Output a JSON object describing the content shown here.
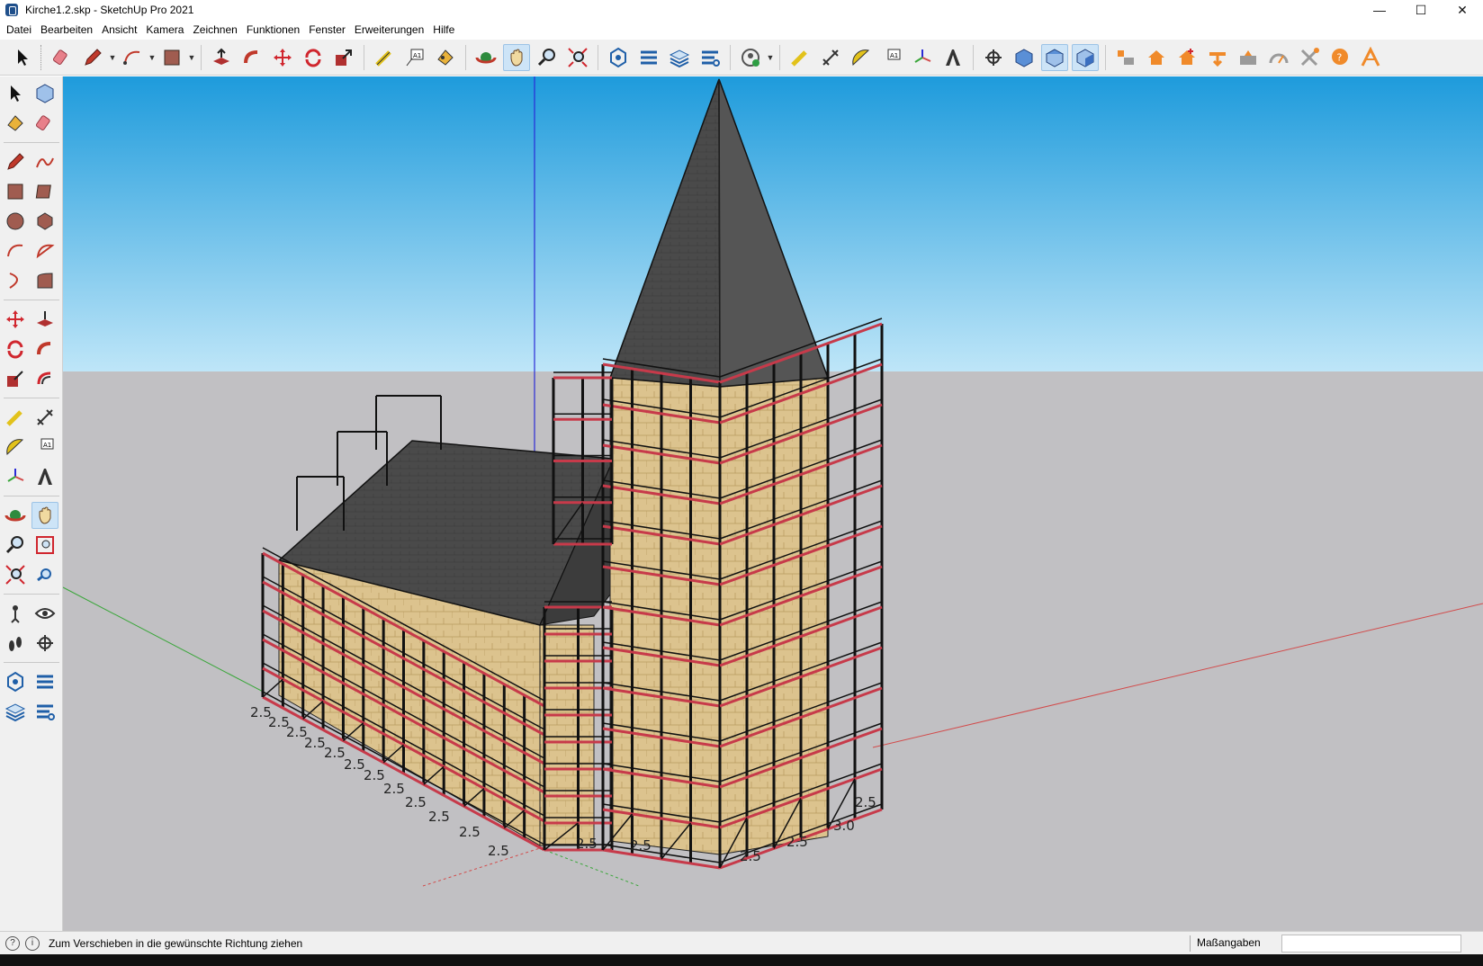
{
  "window": {
    "title": "Kirche1.2.skp - SketchUp Pro 2021",
    "minimize": "—",
    "maximize": "☐",
    "close": "✕"
  },
  "menu": [
    "Datei",
    "Bearbeiten",
    "Ansicht",
    "Kamera",
    "Zeichnen",
    "Funktionen",
    "Fenster",
    "Erweiterungen",
    "Hilfe"
  ],
  "status": {
    "message": "Zum Verschieben in die gewünschte Richtung ziehen",
    "measure_label": "Maßangaben",
    "measure_value": "",
    "info_icon": "i",
    "help_icon": "?"
  },
  "scene": {
    "dimension_labels": [
      "2.5",
      "2.5",
      "2.5",
      "2.5",
      "2.5",
      "2.5",
      "2.5",
      "2.5",
      "2.5",
      "2.5",
      "2.5",
      "2.5",
      "2.5",
      "2.5",
      "2.5",
      "2.5",
      "3.0",
      "2.5"
    ],
    "colors": {
      "sky_top": "#1e9bdc",
      "sky_bottom": "#bfe6f8",
      "ground": "#c1c0c3",
      "roof": "#4a4a4a",
      "wall": "#dcc38e",
      "scaffold": "#111111",
      "deck": "#c73a4a",
      "axis_red": "#d24b4b",
      "axis_green": "#3aa63a",
      "axis_blue": "#2b2bd6"
    }
  },
  "icons": {
    "top": [
      "select-icon",
      "eraser-icon",
      "pencil-icon",
      "arc-icon",
      "rectangle-icon",
      "pushpull-icon",
      "followme-icon",
      "move-icon",
      "rotate-icon",
      "scale-icon",
      "tape-icon",
      "text-icon",
      "paint-icon",
      "orbit-icon",
      "pan-icon",
      "zoom-icon",
      "zoom-extents-icon",
      "warehouse-icon",
      "extension-icon",
      "layers-icon",
      "extension-manager-icon",
      "user-icon",
      "measure-icon",
      "protractor-icon",
      "axes-icon",
      "dimension-icon",
      "3dtext-icon",
      "section-icon",
      "view-iso-icon",
      "view-top-icon",
      "view-front-icon",
      "view-right-icon",
      "addon-1-icon",
      "addon-2-icon",
      "addon-3-icon",
      "addon-4-icon",
      "addon-5-icon",
      "addon-6-icon",
      "addon-7-icon",
      "addon-8-icon",
      "addon-9-icon"
    ],
    "left": [
      "select-icon",
      "component-icon",
      "paint-icon",
      "eraser-icon",
      "pencil-icon",
      "freehand-icon",
      "rectangle-icon",
      "rotated-rectangle-icon",
      "circle-icon",
      "polygon-icon",
      "arc-icon",
      "pie-icon",
      "arc3-icon",
      "offset-icon",
      "move-icon",
      "pushpull-icon",
      "rotate-icon",
      "followme-icon",
      "scale-icon",
      "offset2-icon",
      "tape-icon",
      "dimension-icon",
      "protractor-icon",
      "text-icon",
      "axes-icon",
      "3dtext-icon",
      "orbit-icon",
      "pan-icon",
      "zoom-icon",
      "zoom-window-icon",
      "zoom-extents-icon",
      "previous-view-icon",
      "position-camera-icon",
      "lookaround-icon",
      "walk-icon",
      "section-icon",
      "warehouse-icon",
      "extension-icon",
      "layers-icon",
      "extension-manager-icon"
    ]
  }
}
